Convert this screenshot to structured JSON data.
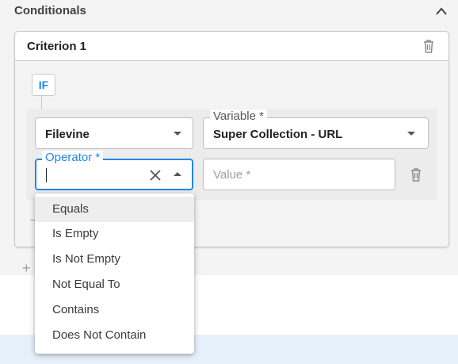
{
  "section": {
    "title": "Conditionals",
    "collapse_icon": "chevron-up-icon"
  },
  "criterion": {
    "title": "Criterion 1",
    "delete_icon": "trash-icon"
  },
  "condition": {
    "badge": "IF",
    "source_field": {
      "value": "Filevine"
    },
    "variable_field": {
      "label": "Variable *",
      "value": "Super Collection - URL"
    },
    "operator_field": {
      "label": "Operator *",
      "value": ""
    },
    "value_field": {
      "placeholder": "Value *"
    },
    "row_delete_icon": "trash-icon"
  },
  "add": {
    "icon": "plus-icon"
  },
  "operator_options": [
    "Equals",
    "Is Empty",
    "Is Not Empty",
    "Not Equal To",
    "Contains",
    "Does Not Contain"
  ],
  "highlighted_option": "Equals",
  "colors": {
    "accent": "#1e88e5",
    "border": "#bdbdbd",
    "panel": "#f4f4f4"
  }
}
